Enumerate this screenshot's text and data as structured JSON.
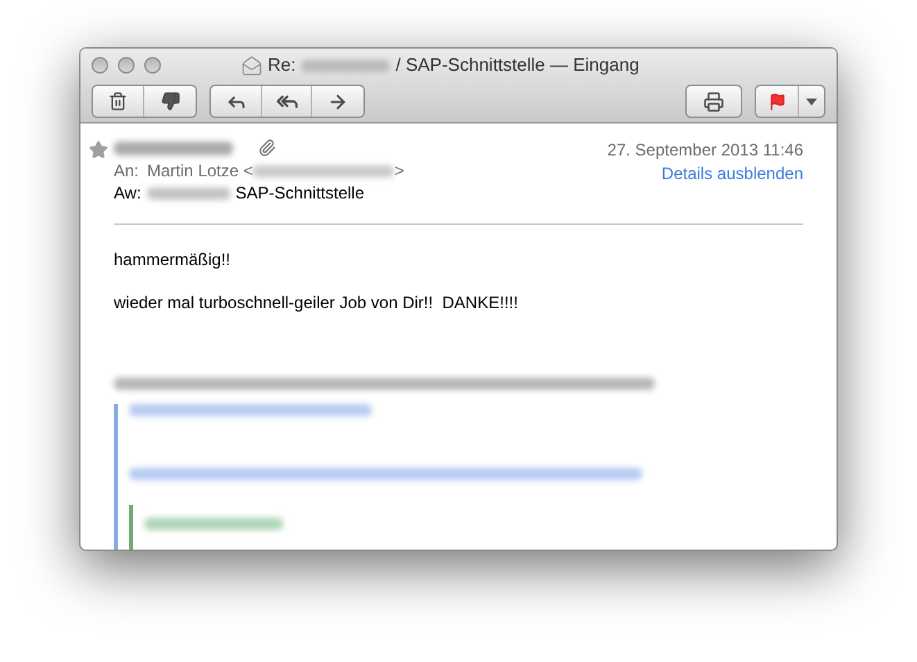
{
  "window": {
    "title_prefix": "Re:",
    "title_suffix": "/ SAP-Schnittstelle — Eingang"
  },
  "message": {
    "date": "27. September 2013 11:46",
    "details_link": "Details ausblenden",
    "to_label": "An:",
    "to_name": "Martin Lotze <",
    "to_close": ">",
    "subject_label": "Aw:",
    "subject": "SAP-Schnittstelle"
  },
  "body": [
    "hammermäßig!!",
    "wieder mal turboschnell-geiler Job von Dir!!  DANKE!!!!"
  ]
}
